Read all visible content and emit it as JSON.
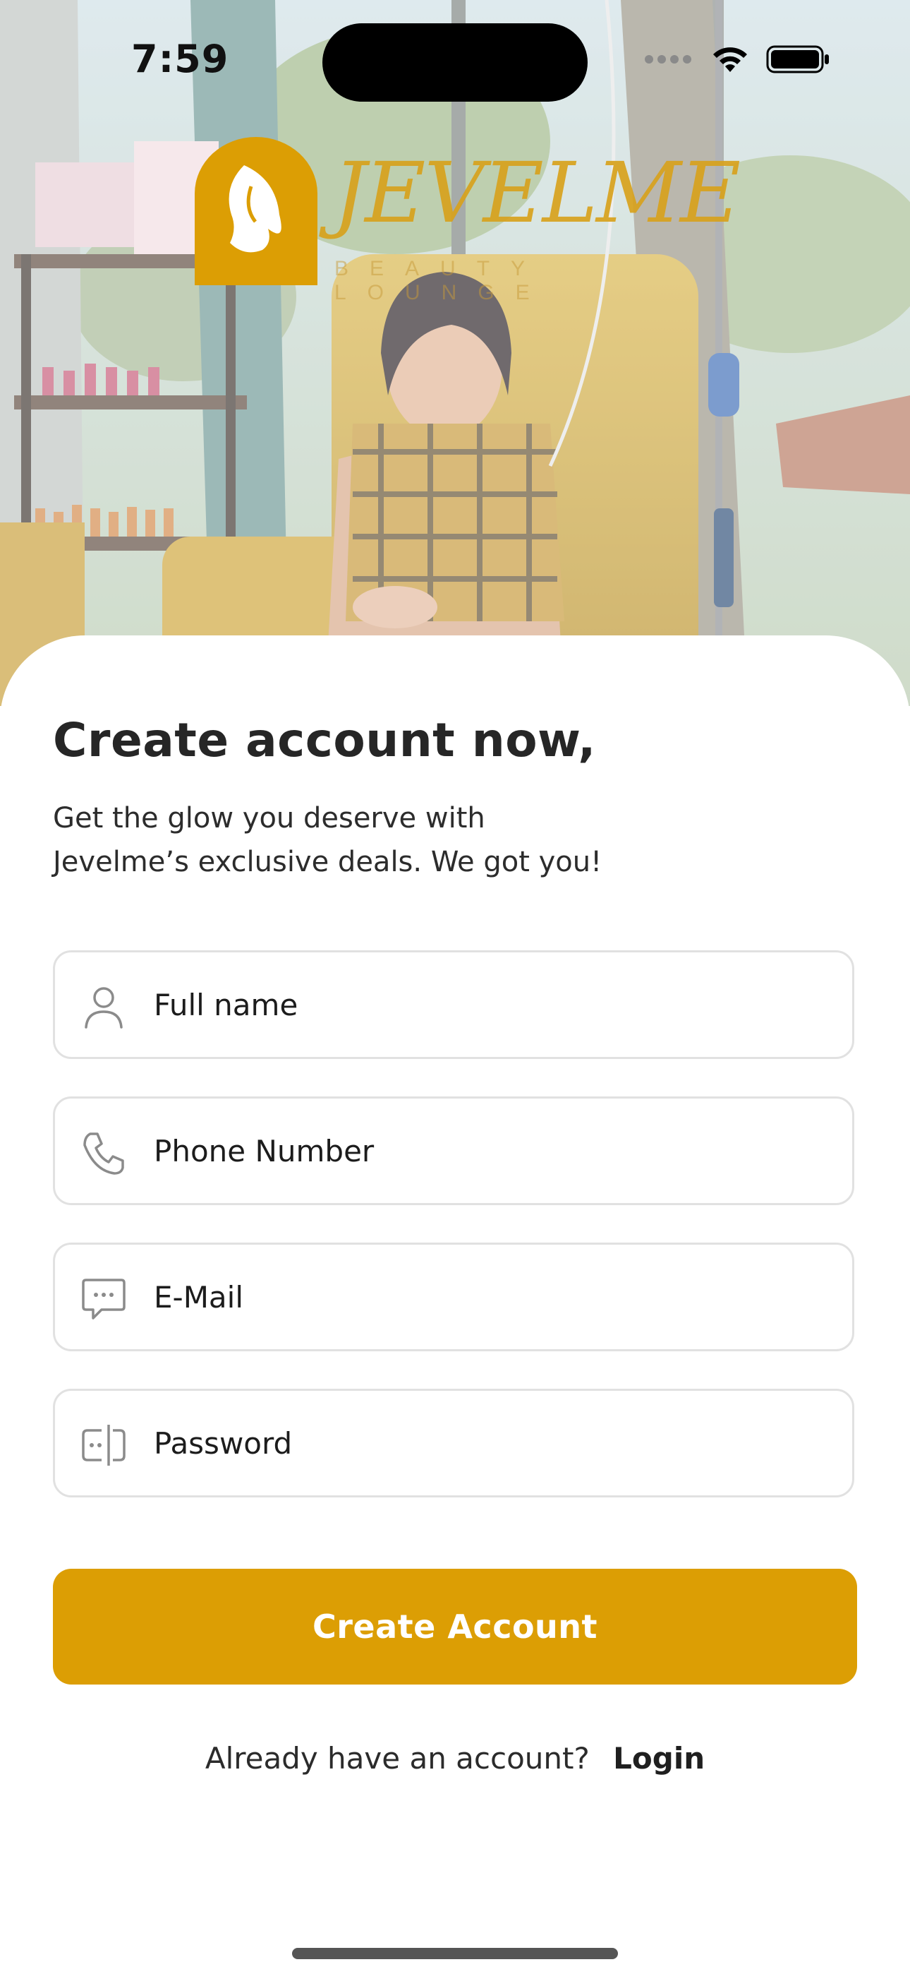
{
  "status_bar": {
    "time": "7:59",
    "icons": [
      "signal-dots-icon",
      "wifi-icon",
      "battery-icon"
    ]
  },
  "brand": {
    "logo_text": "JEVELME",
    "logo_subtitle": "BEAUTY LOUNGE",
    "accent_color": "#DC9E04"
  },
  "heading": {
    "title": "Create account now,",
    "subtitle_line1": "Get the glow you deserve with",
    "subtitle_line2": "Jevelme’s exclusive deals. We got you!"
  },
  "form": {
    "fields": [
      {
        "placeholder": "Full name",
        "icon": "user-icon",
        "value": ""
      },
      {
        "placeholder": "Phone Number",
        "icon": "phone-icon",
        "value": ""
      },
      {
        "placeholder": "E-Mail",
        "icon": "chat-bubble-icon",
        "value": ""
      },
      {
        "placeholder": "Password",
        "icon": "password-icon",
        "value": ""
      }
    ],
    "submit_label": "Create Account"
  },
  "footer": {
    "prompt": "Already have an account?",
    "login_label": "Login"
  }
}
